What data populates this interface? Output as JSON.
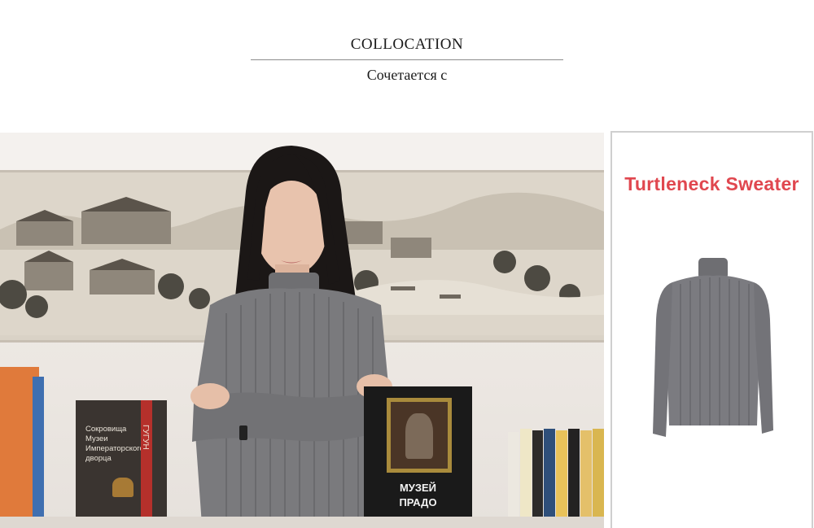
{
  "header": {
    "title": "COLLOCATION",
    "subtitle": "Сочетается с"
  },
  "product_card": {
    "title": "Turtleneck Sweater"
  },
  "photo": {
    "book_left_title_lines": [
      "Сокровища",
      "Музеи",
      "Императорского",
      "дворца"
    ],
    "book_left_spine": "ГУГУН",
    "book_right_title_lines": [
      "МУЗЕЙ",
      "ПРАДО"
    ]
  },
  "colors": {
    "card_title": "#e0474f",
    "sweater": "#7a7a7d",
    "rule": "#8c8c8c"
  }
}
